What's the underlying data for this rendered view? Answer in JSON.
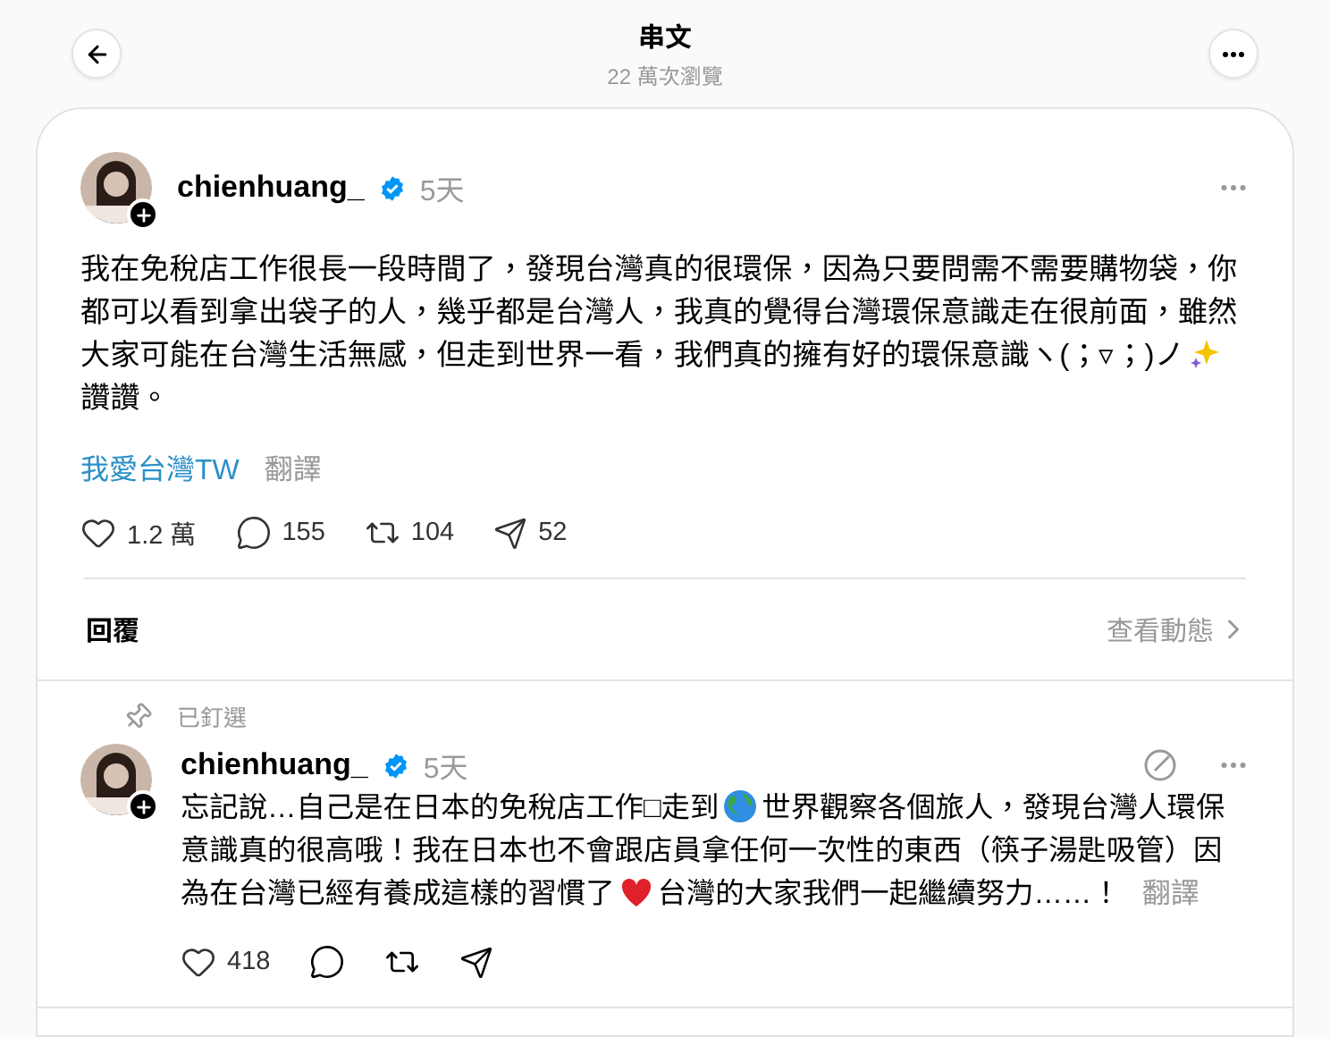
{
  "header": {
    "title": "串文",
    "subtitle": "22 萬次瀏覽"
  },
  "post": {
    "username": "chienhuang_",
    "verified": true,
    "time": "5天",
    "body": [
      {
        "kind": "text",
        "text": "我在免稅店工作很長一段時間了，發現台灣真的很環保，因為只要問需不需要購物袋，你都可以看到拿出袋子的人，幾乎都是台灣人，我真的覺得台灣環保意識走在很前面，雖然大家可能在台灣生活無感，但走到世界一看，我們真的擁有好的環保意識ヽ(；▿；)ノ"
      },
      {
        "kind": "sparkles"
      },
      {
        "kind": "text",
        "text": "讚讚。"
      }
    ],
    "tag": "我愛台灣TW",
    "translate": "翻譯",
    "stats": {
      "likes": "1.2 萬",
      "comments": "155",
      "reposts": "104",
      "shares": "52"
    }
  },
  "replies_bar": {
    "label": "回覆",
    "activity": "查看動態"
  },
  "reply": {
    "pinned_label": "已釘選",
    "username": "chienhuang_",
    "verified": true,
    "time": "5天",
    "body": [
      {
        "kind": "text",
        "text": "忘記說…自己是在日本的免稅店工作□走到"
      },
      {
        "kind": "globe"
      },
      {
        "kind": "text",
        "text": "世界觀察各個旅人，發現台灣人環保意識真的很高哦！我在日本也不會跟店員拿任何一次性的東西（筷子湯匙吸管）因為在台灣已經有養成這樣的習慣了"
      },
      {
        "kind": "heart"
      },
      {
        "kind": "text",
        "text": "台灣的大家我們一起繼續努力……！"
      }
    ],
    "translate": "翻譯",
    "likes": "418"
  }
}
